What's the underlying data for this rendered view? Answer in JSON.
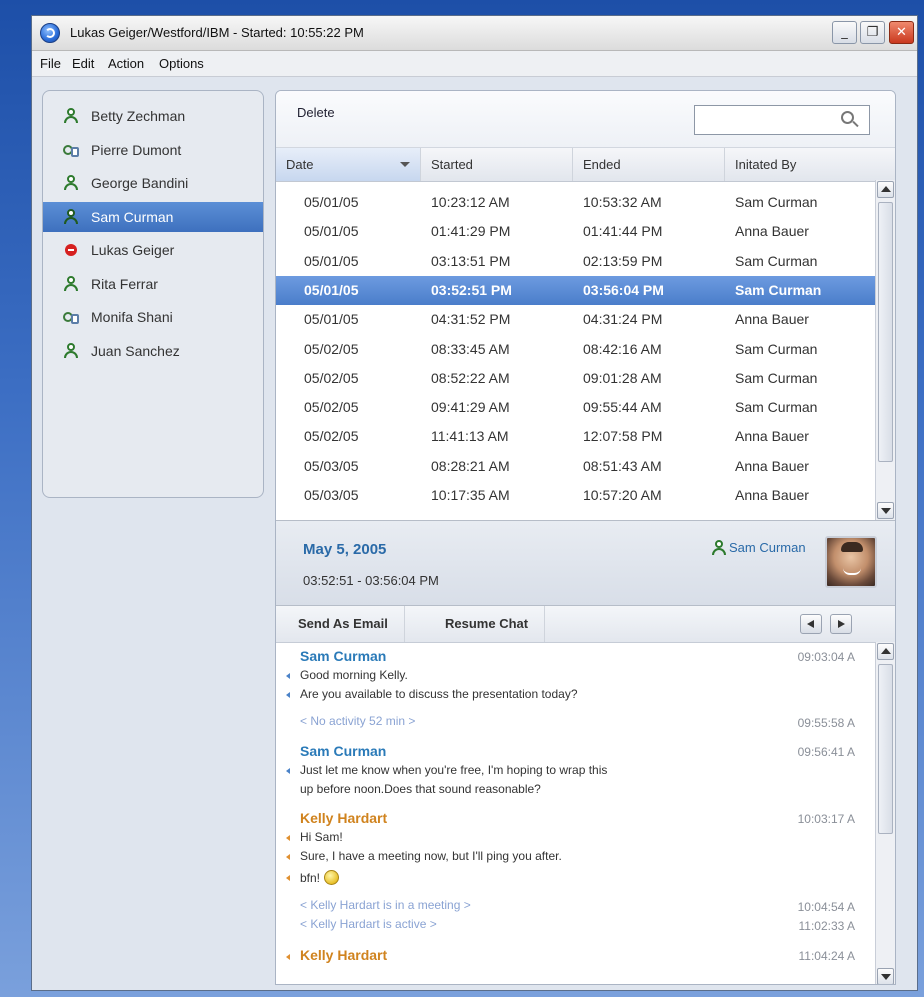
{
  "window": {
    "title": "Lukas Geiger/Westford/IBM - Started: 10:55:22 PM"
  },
  "menu": [
    "File",
    "Edit",
    "Action",
    "Options"
  ],
  "contacts": [
    {
      "name": "Betty Zechman",
      "icon": "person-icon",
      "status": "online"
    },
    {
      "name": "Pierre Dumont",
      "icon": "mobile-icon",
      "status": "mobile"
    },
    {
      "name": "George Bandini",
      "icon": "person-icon",
      "status": "online"
    },
    {
      "name": "Sam Curman",
      "icon": "person-icon",
      "status": "online",
      "selected": true
    },
    {
      "name": "Lukas Geiger",
      "icon": "busy-icon",
      "status": "do-not-disturb"
    },
    {
      "name": "Rita Ferrar",
      "icon": "person-icon",
      "status": "online"
    },
    {
      "name": "Monifa Shani",
      "icon": "mobile-icon",
      "status": "mobile"
    },
    {
      "name": "Juan Sanchez",
      "icon": "person-icon",
      "status": "online"
    }
  ],
  "toolbar": {
    "delete_label": "Delete",
    "search_value": ""
  },
  "table": {
    "columns": [
      "Date",
      "Started",
      "Ended",
      "Initated By"
    ],
    "rows": [
      [
        "05/01/05",
        "10:23:12 AM",
        "10:53:32 AM",
        "Sam Curman"
      ],
      [
        "05/01/05",
        "01:41:29 PM",
        "01:41:44  PM",
        "Anna Bauer"
      ],
      [
        "05/01/05",
        "03:13:51 PM",
        "02:13:59 PM",
        "Sam Curman"
      ],
      [
        "05/01/05",
        "03:52:51 PM",
        "03:56:04 PM",
        "Sam Curman"
      ],
      [
        "05/01/05",
        "04:31:52 PM",
        "04:31:24 PM",
        "Anna Bauer"
      ],
      [
        "05/02/05",
        "08:33:45 AM",
        "08:42:16 AM",
        "Sam Curman"
      ],
      [
        "05/02/05",
        "08:52:22 AM",
        "09:01:28 AM",
        "Sam Curman"
      ],
      [
        "05/02/05",
        "09:41:29 AM",
        "09:55:44 AM",
        "Sam Curman"
      ],
      [
        "05/02/05",
        "11:41:13 AM",
        "12:07:58 PM",
        "Anna Bauer"
      ],
      [
        "05/03/05",
        "08:28:21 AM",
        "08:51:43 AM",
        "Anna Bauer"
      ],
      [
        "05/03/05",
        "10:17:35 AM",
        "10:57:20 AM",
        "Anna Bauer"
      ]
    ],
    "selected_row": 3
  },
  "detail": {
    "date": "May 5, 2005",
    "time_range": "03:52:51 - 03:56:04 PM",
    "user": "Sam Curman"
  },
  "chat_toolbar": {
    "send_email": "Send As Email",
    "resume_chat": "Resume Chat"
  },
  "chat": [
    {
      "type": "name",
      "who": "sam",
      "text": "Sam Curman",
      "time": "09:03:04 A"
    },
    {
      "type": "msg",
      "who": "sam",
      "text": "Good morning Kelly."
    },
    {
      "type": "msg",
      "who": "sam",
      "text": "Are you available to discuss the presentation today?"
    },
    {
      "type": "sys",
      "text": "< No activity 52 min >",
      "time": "09:55:58 A"
    },
    {
      "type": "name",
      "who": "sam",
      "text": "Sam Curman",
      "time": "09:56:41 A"
    },
    {
      "type": "msg",
      "who": "sam",
      "text": "Just let me know when you're free, I'm hoping to wrap this"
    },
    {
      "type": "cont",
      "who": "sam",
      "text": "up before noon.Does that sound reasonable?"
    },
    {
      "type": "name",
      "who": "kelly",
      "text": "Kelly Hardart",
      "time": "10:03:17 A"
    },
    {
      "type": "msg",
      "who": "kelly",
      "text": "Hi Sam!"
    },
    {
      "type": "msg",
      "who": "kelly",
      "text": "Sure, I have a meeting now, but I'll ping you after."
    },
    {
      "type": "msg",
      "who": "kelly",
      "text": "bfn!",
      "emoticon": "smiley-icon"
    },
    {
      "type": "sys",
      "text": "< Kelly Hardart is in a meeting >",
      "time": "10:04:54 A"
    },
    {
      "type": "sys",
      "text": "< Kelly Hardart  is active >",
      "time": "11:02:33 A"
    },
    {
      "type": "name",
      "who": "kelly",
      "text": "Kelly Hardart",
      "time": "11:04:24 A",
      "bullet": true
    }
  ]
}
